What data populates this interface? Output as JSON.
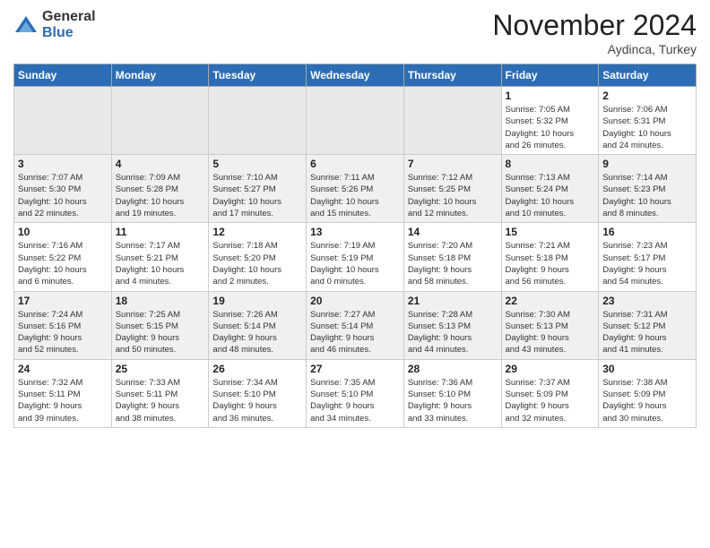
{
  "header": {
    "logo_general": "General",
    "logo_blue": "Blue",
    "month_title": "November 2024",
    "location": "Aydinca, Turkey"
  },
  "weekdays": [
    "Sunday",
    "Monday",
    "Tuesday",
    "Wednesday",
    "Thursday",
    "Friday",
    "Saturday"
  ],
  "weeks": [
    [
      {
        "day": "",
        "info": ""
      },
      {
        "day": "",
        "info": ""
      },
      {
        "day": "",
        "info": ""
      },
      {
        "day": "",
        "info": ""
      },
      {
        "day": "",
        "info": ""
      },
      {
        "day": "1",
        "info": "Sunrise: 7:05 AM\nSunset: 5:32 PM\nDaylight: 10 hours\nand 26 minutes."
      },
      {
        "day": "2",
        "info": "Sunrise: 7:06 AM\nSunset: 5:31 PM\nDaylight: 10 hours\nand 24 minutes."
      }
    ],
    [
      {
        "day": "3",
        "info": "Sunrise: 7:07 AM\nSunset: 5:30 PM\nDaylight: 10 hours\nand 22 minutes."
      },
      {
        "day": "4",
        "info": "Sunrise: 7:09 AM\nSunset: 5:28 PM\nDaylight: 10 hours\nand 19 minutes."
      },
      {
        "day": "5",
        "info": "Sunrise: 7:10 AM\nSunset: 5:27 PM\nDaylight: 10 hours\nand 17 minutes."
      },
      {
        "day": "6",
        "info": "Sunrise: 7:11 AM\nSunset: 5:26 PM\nDaylight: 10 hours\nand 15 minutes."
      },
      {
        "day": "7",
        "info": "Sunrise: 7:12 AM\nSunset: 5:25 PM\nDaylight: 10 hours\nand 12 minutes."
      },
      {
        "day": "8",
        "info": "Sunrise: 7:13 AM\nSunset: 5:24 PM\nDaylight: 10 hours\nand 10 minutes."
      },
      {
        "day": "9",
        "info": "Sunrise: 7:14 AM\nSunset: 5:23 PM\nDaylight: 10 hours\nand 8 minutes."
      }
    ],
    [
      {
        "day": "10",
        "info": "Sunrise: 7:16 AM\nSunset: 5:22 PM\nDaylight: 10 hours\nand 6 minutes."
      },
      {
        "day": "11",
        "info": "Sunrise: 7:17 AM\nSunset: 5:21 PM\nDaylight: 10 hours\nand 4 minutes."
      },
      {
        "day": "12",
        "info": "Sunrise: 7:18 AM\nSunset: 5:20 PM\nDaylight: 10 hours\nand 2 minutes."
      },
      {
        "day": "13",
        "info": "Sunrise: 7:19 AM\nSunset: 5:19 PM\nDaylight: 10 hours\nand 0 minutes."
      },
      {
        "day": "14",
        "info": "Sunrise: 7:20 AM\nSunset: 5:18 PM\nDaylight: 9 hours\nand 58 minutes."
      },
      {
        "day": "15",
        "info": "Sunrise: 7:21 AM\nSunset: 5:18 PM\nDaylight: 9 hours\nand 56 minutes."
      },
      {
        "day": "16",
        "info": "Sunrise: 7:23 AM\nSunset: 5:17 PM\nDaylight: 9 hours\nand 54 minutes."
      }
    ],
    [
      {
        "day": "17",
        "info": "Sunrise: 7:24 AM\nSunset: 5:16 PM\nDaylight: 9 hours\nand 52 minutes."
      },
      {
        "day": "18",
        "info": "Sunrise: 7:25 AM\nSunset: 5:15 PM\nDaylight: 9 hours\nand 50 minutes."
      },
      {
        "day": "19",
        "info": "Sunrise: 7:26 AM\nSunset: 5:14 PM\nDaylight: 9 hours\nand 48 minutes."
      },
      {
        "day": "20",
        "info": "Sunrise: 7:27 AM\nSunset: 5:14 PM\nDaylight: 9 hours\nand 46 minutes."
      },
      {
        "day": "21",
        "info": "Sunrise: 7:28 AM\nSunset: 5:13 PM\nDaylight: 9 hours\nand 44 minutes."
      },
      {
        "day": "22",
        "info": "Sunrise: 7:30 AM\nSunset: 5:13 PM\nDaylight: 9 hours\nand 43 minutes."
      },
      {
        "day": "23",
        "info": "Sunrise: 7:31 AM\nSunset: 5:12 PM\nDaylight: 9 hours\nand 41 minutes."
      }
    ],
    [
      {
        "day": "24",
        "info": "Sunrise: 7:32 AM\nSunset: 5:11 PM\nDaylight: 9 hours\nand 39 minutes."
      },
      {
        "day": "25",
        "info": "Sunrise: 7:33 AM\nSunset: 5:11 PM\nDaylight: 9 hours\nand 38 minutes."
      },
      {
        "day": "26",
        "info": "Sunrise: 7:34 AM\nSunset: 5:10 PM\nDaylight: 9 hours\nand 36 minutes."
      },
      {
        "day": "27",
        "info": "Sunrise: 7:35 AM\nSunset: 5:10 PM\nDaylight: 9 hours\nand 34 minutes."
      },
      {
        "day": "28",
        "info": "Sunrise: 7:36 AM\nSunset: 5:10 PM\nDaylight: 9 hours\nand 33 minutes."
      },
      {
        "day": "29",
        "info": "Sunrise: 7:37 AM\nSunset: 5:09 PM\nDaylight: 9 hours\nand 32 minutes."
      },
      {
        "day": "30",
        "info": "Sunrise: 7:38 AM\nSunset: 5:09 PM\nDaylight: 9 hours\nand 30 minutes."
      }
    ]
  ]
}
